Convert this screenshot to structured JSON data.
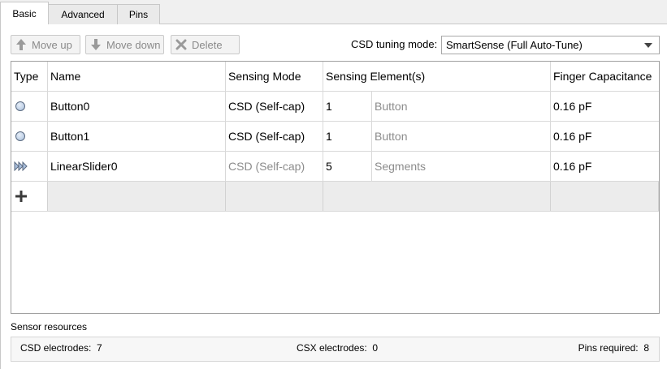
{
  "tabs": [
    {
      "label": "Basic",
      "active": true
    },
    {
      "label": "Advanced",
      "active": false
    },
    {
      "label": "Pins",
      "active": false
    }
  ],
  "toolbar": {
    "move_up": "Move up",
    "move_down": "Move down",
    "delete": "Delete",
    "tuning_label": "CSD tuning mode:",
    "tuning_value": "SmartSense (Full Auto-Tune)"
  },
  "table": {
    "headers": [
      "Type",
      "Name",
      "Sensing Mode",
      "Sensing Element(s)",
      "Finger Capacitance"
    ],
    "rows": [
      {
        "type_icon": "button-widget-icon",
        "name": "Button0",
        "mode": "CSD (Self-cap)",
        "count": "1",
        "element": "Button",
        "capacitance": "0.16 pF"
      },
      {
        "type_icon": "button-widget-icon",
        "name": "Button1",
        "mode": "CSD (Self-cap)",
        "count": "1",
        "element": "Button",
        "capacitance": "0.16 pF"
      },
      {
        "type_icon": "linear-slider-icon",
        "name": "LinearSlider0",
        "mode": "CSD (Self-cap)",
        "count": "5",
        "element": "Segments",
        "capacitance": "0.16 pF"
      }
    ]
  },
  "resources": {
    "title": "Sensor resources",
    "csd_label": "CSD electrodes:",
    "csd_value": "7",
    "csx_label": "CSX electrodes:",
    "csx_value": "0",
    "pins_label": "Pins required:",
    "pins_value": "8"
  }
}
